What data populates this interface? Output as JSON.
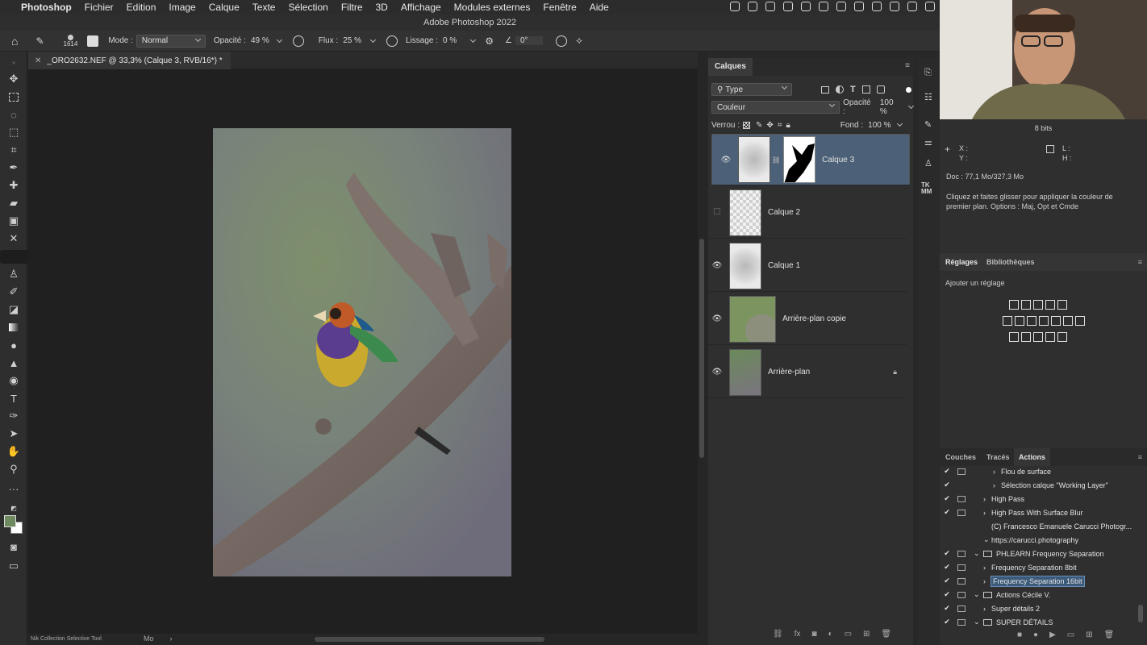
{
  "menubar": {
    "app": "Photoshop",
    "items": [
      "Fichier",
      "Edition",
      "Image",
      "Calque",
      "Texte",
      "Sélection",
      "Filtre",
      "3D",
      "Affichage",
      "Modules externes",
      "Fenêtre",
      "Aide"
    ]
  },
  "window_title": "Adobe Photoshop 2022",
  "options": {
    "brush_size": "1614",
    "mode_label": "Mode :",
    "mode_value": "Normal",
    "opacity_label": "Opacité :",
    "opacity_value": "49 %",
    "flow_label": "Flux :",
    "flow_value": "25 %",
    "smoothing_label": "Lissage :",
    "smoothing_value": "0 %",
    "angle_value": "0°"
  },
  "document": {
    "tab_title": "_ORO2632.NEF @ 33,3% (Calque 3, RVB/16*) *"
  },
  "status": {
    "plugin": "Nik Collection Selective Tool",
    "unit": "Mo"
  },
  "layers_panel": {
    "tab": "Calques",
    "filter": "Type",
    "blend_mode": "Couleur",
    "opacity_label": "Opacité :",
    "opacity_value": "100 %",
    "lock_label": "Verrou :",
    "fill_label": "Fond :",
    "fill_value": "100 %",
    "layers": [
      {
        "name": "Calque 3",
        "visible": true,
        "selected": true
      },
      {
        "name": "Calque 2",
        "visible": false
      },
      {
        "name": "Calque 1",
        "visible": true
      },
      {
        "name": "Arrière-plan copie",
        "visible": true
      },
      {
        "name": "Arrière-plan",
        "visible": true,
        "locked": true
      }
    ]
  },
  "info_panel": {
    "bits": "8 bits",
    "x": "X :",
    "y": "Y :",
    "w": "L :",
    "h": "H :",
    "doc": "Doc : 77,1 Mo/327,3 Mo",
    "hint": "Cliquez et faites glisser pour appliquer la couleur de premier plan. Options : Maj, Opt et Cmde"
  },
  "adjust_panel": {
    "tabs": [
      "Réglages",
      "Bibliothèques"
    ],
    "add": "Ajouter un réglage"
  },
  "actions_panel": {
    "tabs": [
      "Couches",
      "Tracés",
      "Actions"
    ],
    "items": [
      {
        "label": "Flou de surface",
        "indent": 2,
        "check": true,
        "box": true,
        "arrow": "›",
        "folder": false
      },
      {
        "label": "Sélection calque \"Working Layer\"",
        "indent": 2,
        "check": true,
        "box": false,
        "arrow": "›",
        "folder": false
      },
      {
        "label": "High Pass",
        "indent": 1,
        "check": true,
        "box": true,
        "arrow": "›",
        "folder": false
      },
      {
        "label": "High Pass With Surface Blur",
        "indent": 1,
        "check": true,
        "box": true,
        "arrow": "›",
        "folder": false
      },
      {
        "label": "(C) Francesco Emanuele Carucci Photogr...",
        "indent": 1,
        "check": false,
        "box": false,
        "arrow": "",
        "folder": false
      },
      {
        "label": "https://carucci.photography",
        "indent": 1,
        "check": false,
        "box": false,
        "arrow": "⌄",
        "folder": false
      },
      {
        "label": "PHLEARN Frequency Separation",
        "indent": 0,
        "check": true,
        "box": true,
        "arrow": "⌄",
        "folder": true
      },
      {
        "label": "Frequency Separation 8bit",
        "indent": 1,
        "check": true,
        "box": true,
        "arrow": "›",
        "folder": false
      },
      {
        "label": "Frequency Separation 16bit",
        "indent": 1,
        "check": true,
        "box": true,
        "arrow": "›",
        "folder": false,
        "highlight": true
      },
      {
        "label": "Actions Cécile V.",
        "indent": 0,
        "check": true,
        "box": true,
        "arrow": "⌄",
        "folder": true
      },
      {
        "label": "Super détails 2",
        "indent": 1,
        "check": true,
        "box": true,
        "arrow": "›",
        "folder": false
      },
      {
        "label": "SUPER DÉTAILS",
        "indent": 0,
        "check": true,
        "box": true,
        "arrow": "⌄",
        "folder": true
      }
    ]
  },
  "colors": {
    "selection": "#4c6178",
    "panel": "#2f2f2f",
    "canvas": "#202020"
  }
}
